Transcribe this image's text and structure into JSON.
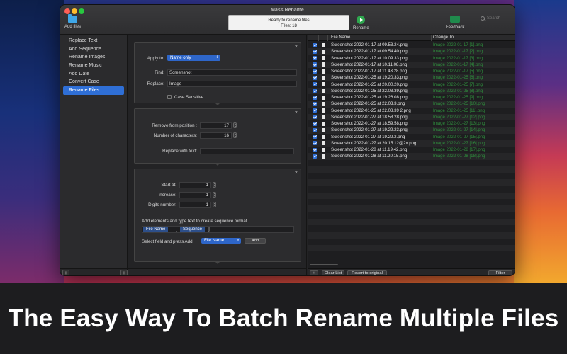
{
  "window": {
    "title": "Mass Rename"
  },
  "toolbar": {
    "add_files_label": "Add files",
    "status_line1": "Ready to rename files",
    "status_line2": "Files: 18",
    "rename_label": "Rename",
    "feedback_label": "Feedback",
    "search_placeholder": "Search"
  },
  "sidebar": {
    "items": [
      {
        "label": "Replace Text"
      },
      {
        "label": "Add Sequence"
      },
      {
        "label": "Rename Images"
      },
      {
        "label": "Rename Music"
      },
      {
        "label": "Add Date"
      },
      {
        "label": "Convert Case"
      },
      {
        "label": "Rename Files",
        "active": true
      }
    ],
    "add_button": "+"
  },
  "replace_panel": {
    "apply_to_label": "Apply to:",
    "apply_to_value": "Name only",
    "find_label": "Find:",
    "find_value": "Screenshot",
    "replace_label": "Replace:",
    "replace_value": "Image",
    "case_sensitive_label": "Case Sensitive",
    "close": "×"
  },
  "remove_panel": {
    "from_label": "Remove from position :",
    "from_value": "17",
    "chars_label": "Number of characters:",
    "chars_value": "16",
    "replace_with_label": "Replace with text:",
    "replace_with_value": "",
    "close": "×"
  },
  "sequence_panel": {
    "start_label": "Start at:",
    "start_value": "1",
    "increase_label": "Increase:",
    "increase_value": "1",
    "digits_label": "Digits number:",
    "digits_value": "1",
    "instructions": "Add elements and type text to create sequence format.",
    "token1": "File Name",
    "bracket_open": "[",
    "token2": "Sequence",
    "bracket_close": "]",
    "select_label": "Select field and press Add:",
    "select_value": "File Name",
    "add_label": "Add",
    "close": "×"
  },
  "middle_footer": {
    "add_button": "+"
  },
  "table": {
    "col_name": "File Name",
    "col_change": "Change To",
    "rows": [
      {
        "name": "Screenshot 2022-01-17 at 09.53.24.png",
        "new": "Image 2022-01-17 [1].png"
      },
      {
        "name": "Screenshot 2022-01-17 at 09.54.40.png",
        "new": "Image 2022-01-17 [2].png"
      },
      {
        "name": "Screenshot 2022-01-17 at 10.09.33.png",
        "new": "Image 2022-01-17 [3].png"
      },
      {
        "name": "Screenshot 2022-01-17 at 10.11.08.png",
        "new": "Image 2022-01-17 [4].png"
      },
      {
        "name": "Screenshot 2022-01-17 at 11.43.28.png",
        "new": "Image 2022-01-17 [5].png"
      },
      {
        "name": "Screenshot 2022-01-25 at 19.20.33.png",
        "new": "Image 2022-01-25 [6].png"
      },
      {
        "name": "Screenshot 2022-01-25 at 20.00.20.png",
        "new": "Image 2022-01-25 [7].png"
      },
      {
        "name": "Screenshot 2022-01-25 at 22.03.39.png",
        "new": "Image 2022-01-25 [8].png"
      },
      {
        "name": "Screenshot 2022-01-25 at 19.26.08.png",
        "new": "Image 2022-01-25 [9].png"
      },
      {
        "name": "Screenshot 2022-01-25 at 22.03.3.png",
        "new": "Image 2022-01-25 [10].png"
      },
      {
        "name": "Screenshot 2022-01-25 at 22.03.39 2.png",
        "new": "Image 2022-01-25 [11].png"
      },
      {
        "name": "Screenshot 2022-01-27 at 18.58.28.png",
        "new": "Image 2022-01-27 [12].png"
      },
      {
        "name": "Screenshot 2022-01-27 at 18.59.58.png",
        "new": "Image 2022-01-27 [13].png"
      },
      {
        "name": "Screenshot 2022-01-27 at 19.22.23.png",
        "new": "Image 2022-01-27 [14].png"
      },
      {
        "name": "Screenshot 2022-01-27 at 19.22.2.png",
        "new": "Image 2022-01-27 [15].png"
      },
      {
        "name": "Screenshot 2022-01-27 at 20.15.12@2x.png",
        "new": "Image 2022-01-27 [16].png"
      },
      {
        "name": "Screenshot 2022-01-28 at 11.19.42.png",
        "new": "Image 2022-01-28 [17].png"
      },
      {
        "name": "Screenshot 2022-01-28 at 11.20.15.png",
        "new": "Image 2022-01-28 [18].png"
      }
    ]
  },
  "table_footer": {
    "add_button": "+",
    "clear_label": "Clear List",
    "revert_label": "Revert to original",
    "filter_label": "Filter"
  },
  "banner": {
    "tagline": "The Easy Way To Batch Rename Multiple Files"
  },
  "colors": {
    "accent": "#2f6fd6",
    "new_name_text": "#2f8f3d",
    "rename_button": "#2fa84f"
  }
}
